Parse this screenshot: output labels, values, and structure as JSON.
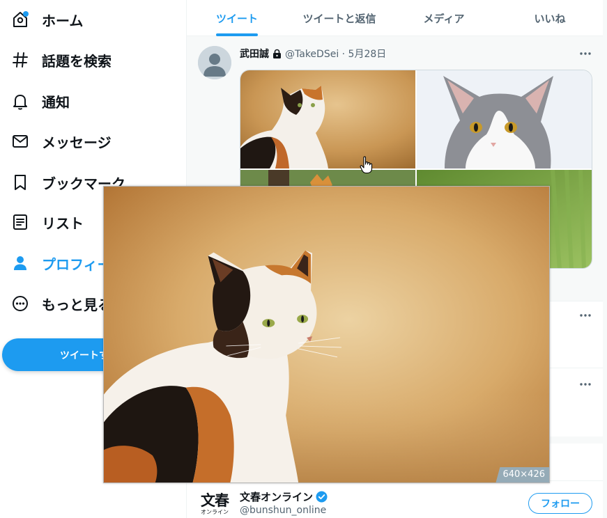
{
  "sidebar": {
    "items": [
      {
        "label": "ホーム",
        "icon": "home-icon"
      },
      {
        "label": "話題を検索",
        "icon": "hashtag-icon"
      },
      {
        "label": "通知",
        "icon": "bell-icon"
      },
      {
        "label": "メッセージ",
        "icon": "mail-icon"
      },
      {
        "label": "ブックマーク",
        "icon": "bookmark-icon"
      },
      {
        "label": "リスト",
        "icon": "list-icon"
      },
      {
        "label": "プロフィール",
        "icon": "profile-icon"
      },
      {
        "label": "もっと見る",
        "icon": "more-circle-icon"
      }
    ],
    "tweet_button": "ツイートする"
  },
  "tabs": [
    "ツイート",
    "ツイートと返信",
    "メディア",
    "いいね"
  ],
  "tweet": {
    "author": "武田誠",
    "meta": "@TakeDSei · 5月28日"
  },
  "preview": {
    "size_label": "640×426"
  },
  "suggestion": {
    "logo_main": "文春",
    "logo_sub": "オンライン",
    "name": "文春オンライン",
    "handle": "@bunshun_online",
    "follow": "フォロー"
  },
  "colors": {
    "accent": "#1d9bf0",
    "text": "#0f1419",
    "muted": "#536471"
  }
}
